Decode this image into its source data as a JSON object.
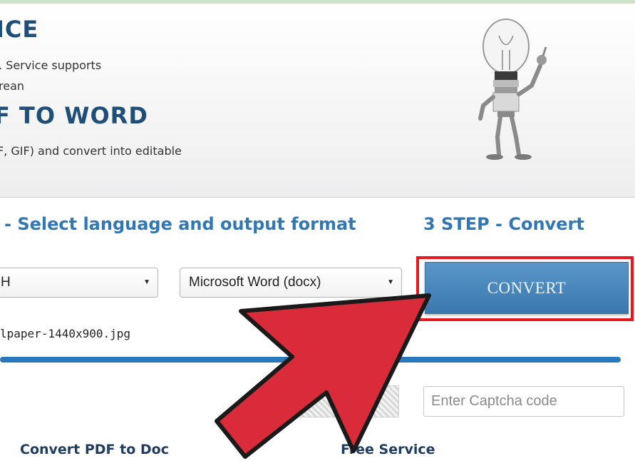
{
  "header": {
    "ocr_heading": "ICE",
    "ocr_desc_1": ". Service supports",
    "ocr_desc_2": "rean",
    "pdf_heading": "F TO WORD",
    "pdf_desc": "F, GIF) and convert into editable"
  },
  "steps": {
    "step2_title": "- Select language and output format",
    "step3_title": "3 STEP - Convert"
  },
  "form": {
    "language_value": "H",
    "format_value": "Microsoft Word (docx)",
    "convert_label": "CONVERT",
    "filename": "lpaper-1440x900.jpg",
    "upload_progress": 1.0,
    "captcha_placeholder": "Enter Captcha code"
  },
  "footer": {
    "link_pdf_to_doc": "Convert PDF to Doc",
    "free_service": "Free Service"
  },
  "colors": {
    "heading": "#1f4e79",
    "step_title": "#2f78b5",
    "convert_button": "#4a88bf",
    "highlight_box": "#e8171e",
    "arrow": "#d92b3a"
  },
  "icons": [
    "lightbulb-robot-illustration",
    "dropdown-arrow-icon",
    "big-red-arrow"
  ]
}
